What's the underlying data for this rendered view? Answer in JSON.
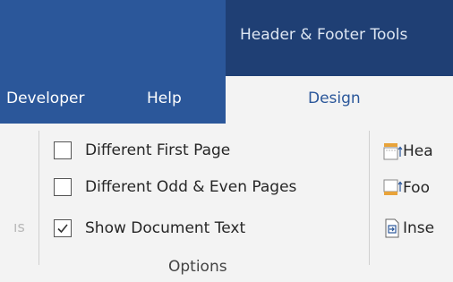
{
  "title_bar": {
    "contextual_label": "Header & Footer Tools"
  },
  "tabs": [
    {
      "label": "Developer"
    },
    {
      "label": "Help"
    },
    {
      "label": "Design",
      "active": true
    }
  ],
  "ribbon": {
    "partial_left_text": "ıs",
    "options_group": {
      "label": "Options",
      "items": [
        {
          "label": "Different First Page",
          "checked": false
        },
        {
          "label": "Different Odd & Even Pages",
          "checked": false
        },
        {
          "label": "Show Document Text",
          "checked": true
        }
      ]
    },
    "right_group": {
      "items": [
        {
          "label": "Hea",
          "icon": "header-position-icon"
        },
        {
          "label": "Foo",
          "icon": "footer-position-icon"
        },
        {
          "label": "Inse",
          "icon": "insert-alignment-tab-icon"
        }
      ]
    }
  },
  "colors": {
    "brand": "#2b579a",
    "contextual": "#1f3f74",
    "ribbon_bg": "#f3f3f3"
  }
}
